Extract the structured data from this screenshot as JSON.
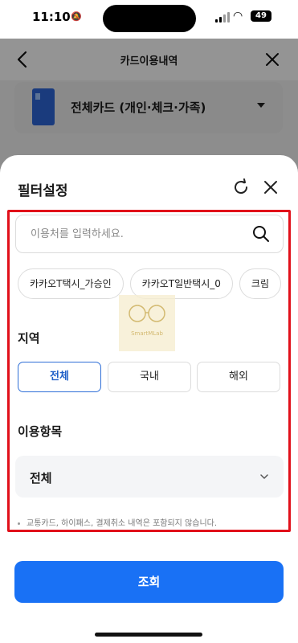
{
  "status": {
    "time": "11:10",
    "battery": "49"
  },
  "nav": {
    "title": "카드이용내역"
  },
  "card_select": {
    "label": "전체카드 (개인·체크·가족)"
  },
  "sheet": {
    "title": "필터설정",
    "search": {
      "placeholder": "이용처를 입력하세요."
    },
    "chips": [
      "카카오T택시_가승인",
      "카카오T일반택시_0",
      "크림"
    ],
    "watermark": "SmartMLab",
    "region": {
      "title": "지역",
      "options": [
        "전체",
        "국내",
        "해외"
      ],
      "selected": "전체"
    },
    "category": {
      "title": "이용항목",
      "value": "전체"
    },
    "notice": "교통카드, 하이패스, 결제취소 내역은 포함되지 않습니다.",
    "submit_label": "조회"
  },
  "colors": {
    "accent": "#1971f5",
    "highlight": "#e1101a",
    "selected_border": "#2f6fd7"
  }
}
